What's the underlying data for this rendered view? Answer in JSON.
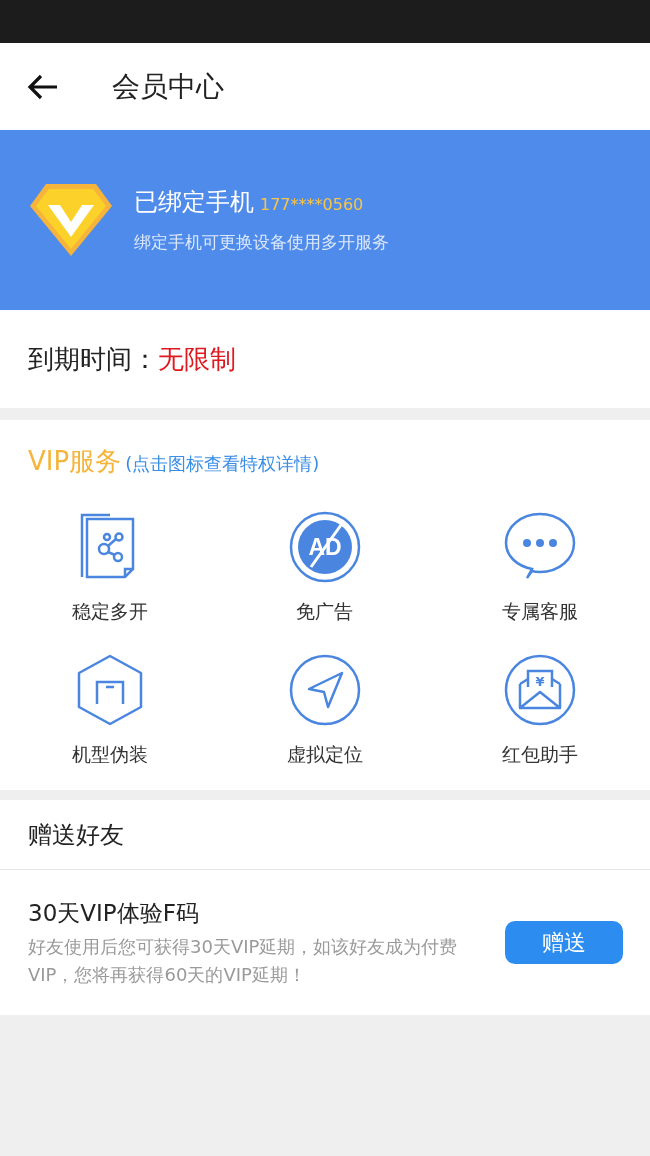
{
  "header": {
    "title": "会员中心"
  },
  "banner": {
    "title": "已绑定手机",
    "phone": "177****0560",
    "subtitle": "绑定手机可更换设备使用多开服务"
  },
  "expiry": {
    "label": "到期时间：",
    "value": "无限制"
  },
  "vip_services": {
    "title": "VIP服务",
    "hint": "(点击图标查看特权详情)",
    "items": [
      {
        "kind": "share",
        "label": "稳定多开"
      },
      {
        "kind": "no-ad",
        "label": "免广告",
        "icon_text": "AD"
      },
      {
        "kind": "chat",
        "label": "专属客服"
      },
      {
        "kind": "device",
        "label": "机型伪装"
      },
      {
        "kind": "location",
        "label": "虚拟定位"
      },
      {
        "kind": "envelope",
        "label": "红包助手",
        "icon_text": "¥"
      }
    ]
  },
  "gift": {
    "title": "赠送好友",
    "items": [
      {
        "title": "30天VIP体验F码",
        "description": "好友使用后您可获得30天VIP延期，如该好友成为付费VIP，您将再获得60天的VIP延期！",
        "button": "赠送"
      }
    ]
  }
}
